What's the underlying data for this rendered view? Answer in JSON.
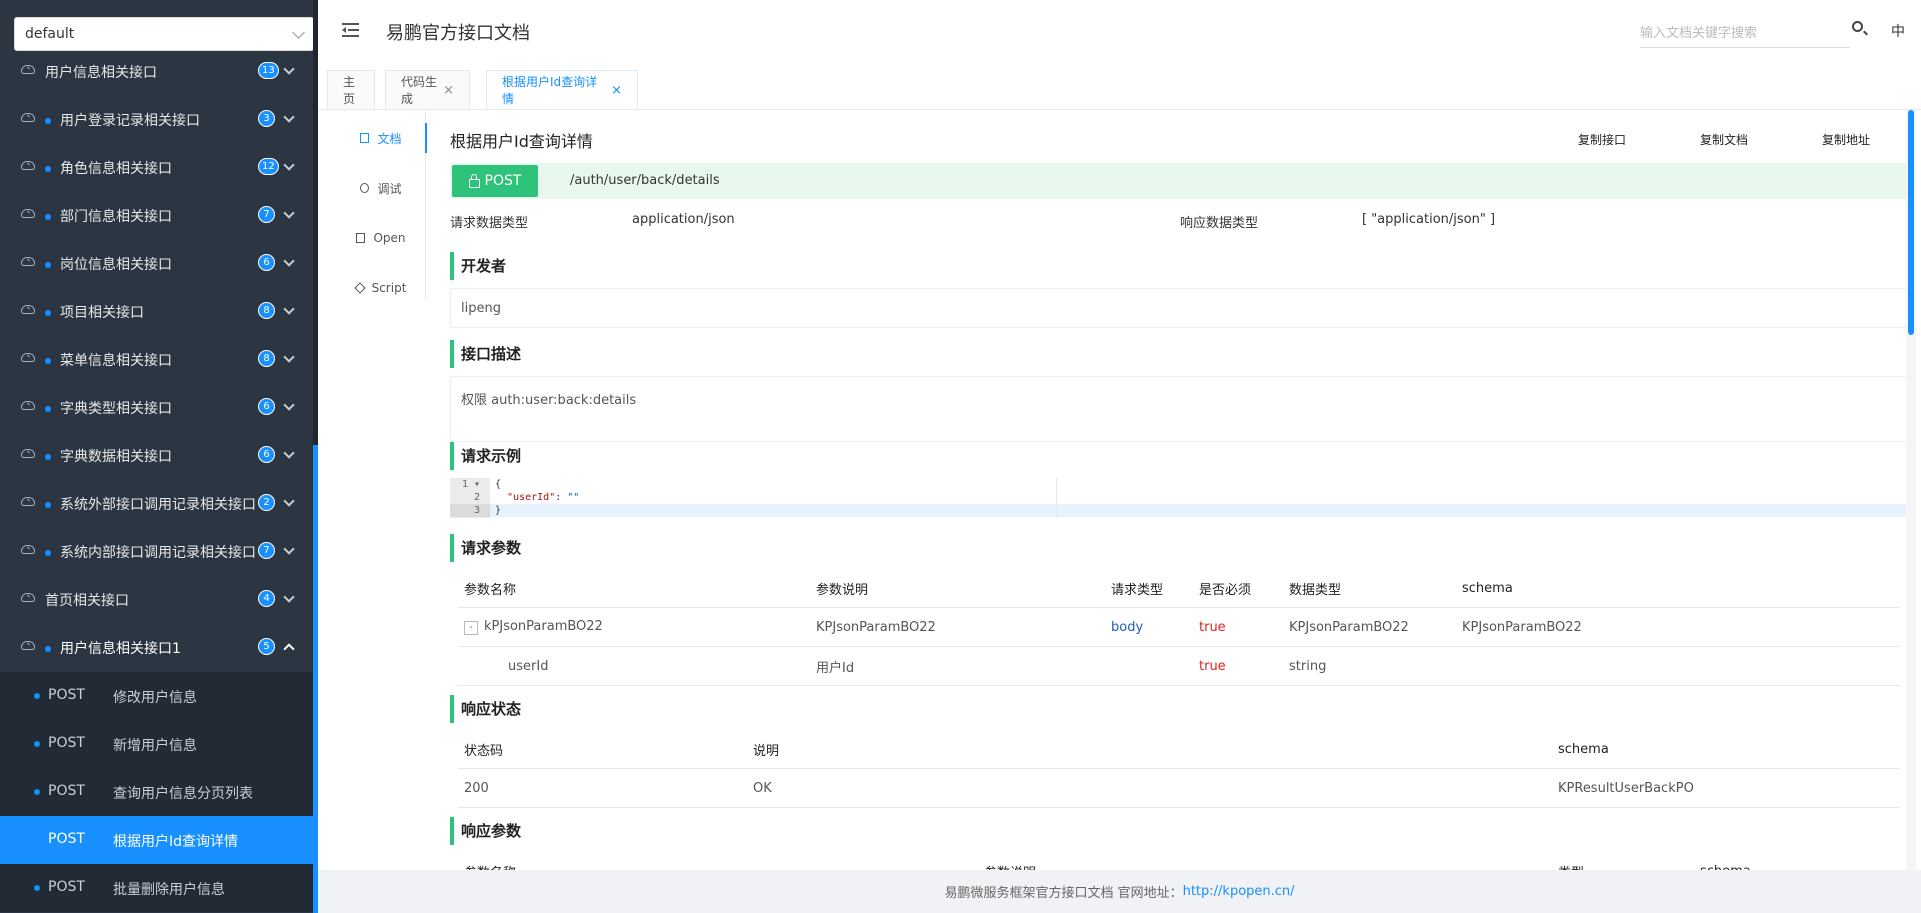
{
  "sidebar": {
    "group_select": "default",
    "menu": [
      {
        "label": "用户信息相关接口",
        "badge": "13",
        "dot": false
      },
      {
        "label": "用户登录记录相关接口",
        "badge": "3",
        "dot": true
      },
      {
        "label": "角色信息相关接口",
        "badge": "12",
        "dot": true
      },
      {
        "label": "部门信息相关接口",
        "badge": "7",
        "dot": true
      },
      {
        "label": "岗位信息相关接口",
        "badge": "6",
        "dot": true
      },
      {
        "label": "项目相关接口",
        "badge": "8",
        "dot": true
      },
      {
        "label": "菜单信息相关接口",
        "badge": "8",
        "dot": true
      },
      {
        "label": "字典类型相关接口",
        "badge": "6",
        "dot": true
      },
      {
        "label": "字典数据相关接口",
        "badge": "6",
        "dot": true
      },
      {
        "label": "系统外部接口调用记录相关接口",
        "badge": "2",
        "dot": true
      },
      {
        "label": "系统内部接口调用记录相关接口",
        "badge": "7",
        "dot": true
      },
      {
        "label": "首页相关接口",
        "badge": "4",
        "dot": false
      },
      {
        "label": "用户信息相关接口1",
        "badge": "5",
        "dot": true
      }
    ],
    "sub_items": [
      {
        "method": "POST",
        "label": "修改用户信息"
      },
      {
        "method": "POST",
        "label": "新增用户信息"
      },
      {
        "method": "POST",
        "label": "查询用户信息分页列表"
      },
      {
        "method": "POST",
        "label": "根据用户Id查询详情"
      },
      {
        "method": "POST",
        "label": "批量删除用户信息"
      }
    ]
  },
  "header": {
    "title": "易鹏官方接口文档",
    "search_placeholder": "输入文档关键字搜索",
    "lang": "中"
  },
  "tabs": [
    {
      "label": "主页",
      "closable": false
    },
    {
      "label": "代码生成",
      "closable": true
    },
    {
      "label": "根据用户Id查询详情",
      "closable": true
    }
  ],
  "side_tabs": [
    "文档",
    "调试",
    "Open",
    "Script"
  ],
  "api": {
    "title": "根据用户Id查询详情",
    "copy_api": "复制接口",
    "copy_doc": "复制文档",
    "copy_url": "复制地址",
    "method": "POST",
    "path": "/auth/user/back/details",
    "req_type_label": "请求数据类型",
    "req_type": "application/json",
    "resp_type_label": "响应数据类型",
    "resp_type": "[ \"application/json\" ]",
    "dev_title": "开发者",
    "developer": "lipeng",
    "desc_title": "接口描述",
    "description": "权限 auth:user:back:details",
    "example_title": "请求示例",
    "example_lines": [
      "{",
      "  \"userId\": \"\"",
      "}"
    ],
    "params_title": "请求参数",
    "params_headers": [
      "参数名称",
      "参数说明",
      "请求类型",
      "是否必须",
      "数据类型",
      "schema"
    ],
    "params_rows": [
      [
        "kPJsonParamBO22",
        "KPJsonParamBO22",
        "body",
        "true",
        "KPJsonParamBO22",
        "KPJsonParamBO22"
      ],
      [
        "userId",
        "用户Id",
        "",
        "true",
        "string",
        ""
      ]
    ],
    "status_title": "响应状态",
    "status_headers": [
      "状态码",
      "说明",
      "schema"
    ],
    "status_rows": [
      [
        "200",
        "OK",
        "KPResultUserBackPO"
      ]
    ],
    "resp_params_title": "响应参数",
    "resp_params_headers": [
      "参数名称",
      "参数说明",
      "类型",
      "schema"
    ]
  },
  "footer": {
    "text": "易鹏微服务框架官方接口文档 官网地址：",
    "link": "http://kpopen.cn/"
  },
  "colors": {
    "sidebar_bg": "#2b3642",
    "accent": "#1890ff",
    "post_green": "#2ec27a"
  }
}
